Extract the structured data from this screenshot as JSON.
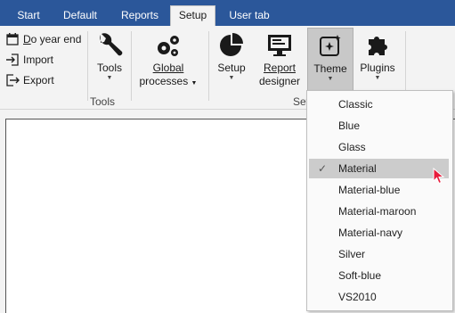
{
  "tabs": [
    {
      "label": "Start",
      "active": false
    },
    {
      "label": "Default",
      "active": false
    },
    {
      "label": "Reports",
      "active": false
    },
    {
      "label": "Setup",
      "active": true
    },
    {
      "label": "User tab",
      "active": false
    }
  ],
  "ribbon": {
    "small_buttons": [
      {
        "label": "Do year end",
        "icon": "calendar-icon"
      },
      {
        "label": "Import",
        "icon": "import-icon"
      },
      {
        "label": "Export",
        "icon": "export-icon"
      }
    ],
    "tools": {
      "label": "Tools",
      "icon": "wrench-icon"
    },
    "global_processes": {
      "label_line1": "Global",
      "label_line2": "processes",
      "icon": "gears-icon"
    },
    "tools_group_label": "Tools",
    "setup": {
      "label": "Setup",
      "icon": "pie-chart-icon"
    },
    "report_designer": {
      "label_line1": "Report",
      "label_line2": "designer",
      "icon": "monitor-icon"
    },
    "theme": {
      "label": "Theme",
      "icon": "theme-sparkle-icon"
    },
    "plugins": {
      "label": "Plugins",
      "icon": "puzzle-icon"
    },
    "setup_group_label": "Set"
  },
  "theme_menu": {
    "items": [
      "Classic",
      "Blue",
      "Glass",
      "Material",
      "Material-blue",
      "Material-maroon",
      "Material-navy",
      "Silver",
      "Soft-blue",
      "VS2010"
    ],
    "selected": "Material",
    "check_glyph": "✓"
  },
  "colors": {
    "tab_bar": "#2b579a",
    "ribbon": "#f3f3f3",
    "pressed": "#c8c8c8",
    "menu_selected": "#cccccc",
    "cursor": "#e81c3c"
  }
}
